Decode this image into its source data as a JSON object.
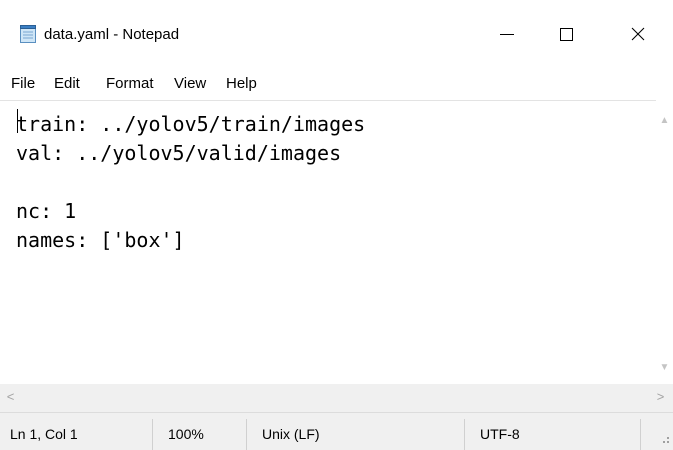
{
  "window": {
    "title": "data.yaml - Notepad",
    "icons": {
      "app": "notepad-icon",
      "minimize": "minimize-icon",
      "maximize": "maximize-icon",
      "close": "close-icon"
    },
    "close_glyph": "✕"
  },
  "menu": {
    "file": "File",
    "edit": "Edit",
    "format": "Format",
    "view": "View",
    "help": "Help"
  },
  "editor": {
    "content": "train: ../yolov5/train/images\nval: ../yolov5/valid/images\n\nnc: 1\nnames: ['box']"
  },
  "scrollbars": {
    "up_arrow": "▲",
    "down_arrow": "▼",
    "left_arrow": "<",
    "right_arrow": ">"
  },
  "status": {
    "position": "Ln 1, Col 1",
    "zoom": "100%",
    "line_ending": "Unix (LF)",
    "encoding": "UTF-8"
  }
}
